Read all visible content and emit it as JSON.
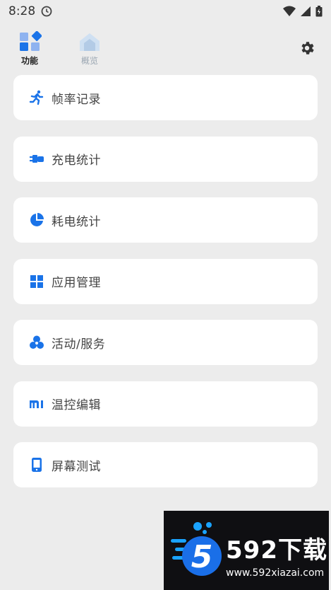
{
  "status_bar": {
    "time": "8:28"
  },
  "header": {
    "tabs": [
      {
        "label": "功能",
        "active": true
      },
      {
        "label": "概览",
        "active": false
      }
    ]
  },
  "menu": {
    "items": [
      {
        "label": "帧率记录",
        "icon": "running-icon"
      },
      {
        "label": "充电统计",
        "icon": "charging-plug-icon"
      },
      {
        "label": "耗电统计",
        "icon": "pie-chart-icon"
      },
      {
        "label": "应用管理",
        "icon": "grid-icon"
      },
      {
        "label": "活动/服务",
        "icon": "circles-icon"
      },
      {
        "label": "温控编辑",
        "icon": "mi-logo-icon"
      },
      {
        "label": "屏幕测试",
        "icon": "phone-screen-icon"
      }
    ]
  },
  "watermark": {
    "title": "592下载",
    "url": "www.592xiazai.com"
  },
  "colors": {
    "accent": "#1a73e8",
    "background": "#ececec",
    "card": "#ffffff"
  }
}
